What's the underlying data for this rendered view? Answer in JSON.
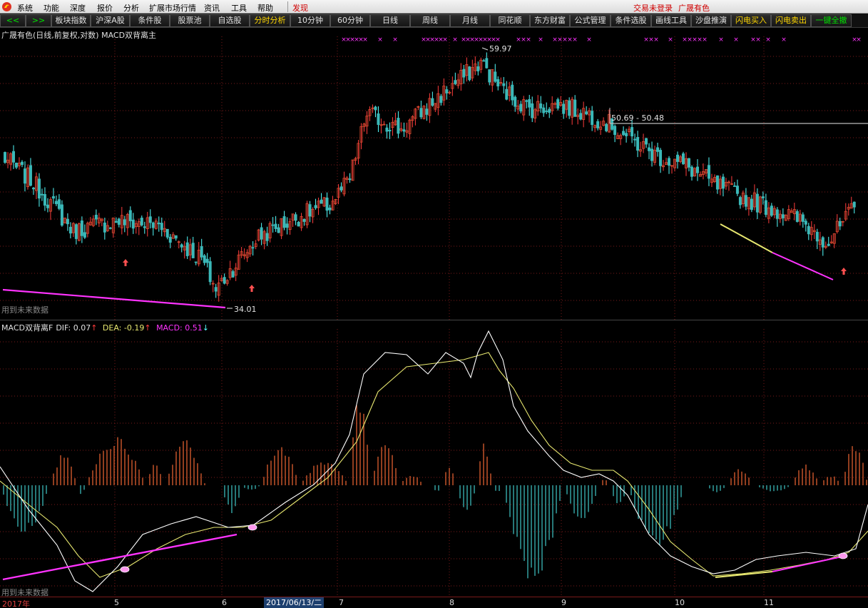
{
  "menu": {
    "items": [
      "系统",
      "功能",
      "深度",
      "报价",
      "分析",
      "扩展市场行情",
      "资讯",
      "工具",
      "帮助"
    ],
    "discover": "发现",
    "login_status": "交易未登录",
    "stock_name": "广晟有色"
  },
  "toolbar": {
    "items": [
      "<<",
      ">>",
      "板块指数",
      "沪深A股",
      "条件股",
      "股票池",
      "自选股",
      "分时分析",
      "10分钟",
      "60分钟",
      "日线",
      "周线",
      "月线",
      "同花顺",
      "东方财富",
      "公式管理",
      "条件选股",
      "画线工具",
      "沙盘推演",
      "闪电买入",
      "闪电卖出",
      "一键全撤"
    ]
  },
  "kline": {
    "title": "广晟有色(日线,前复权,对数) MACD双背离主",
    "high_label": "59.97",
    "low_label": "34.01",
    "range_label": "50.69 - 50.48",
    "future_note": "用到未来数据"
  },
  "macd": {
    "name": "MACD双背离F",
    "dif": "DIF: 0.07",
    "dif_arrow": "↑",
    "dea": "DEA: -0.19",
    "dea_arrow": "↑",
    "macd": "MACD: 0.51",
    "macd_arrow": "↓",
    "future_note": "用到未来数据"
  },
  "timeaxis": {
    "year": "2017年",
    "months": [
      "5",
      "6",
      "7",
      "8",
      "9",
      "10",
      "11"
    ],
    "cursor_date": "2017/06/13/二"
  },
  "colors": {
    "up": "#ff3c3c",
    "up_body": "#e05030",
    "down": "#54ffff",
    "down_body": "#3ab8b8",
    "divergence": "#ff33ff",
    "dif_line": "#ffffff",
    "dea_line": "#e8e870",
    "bar_up": "#e06030",
    "bar_down": "#3ab8b8",
    "grid": "#7a1a1a"
  },
  "chart_data": [
    {
      "type": "candlestick",
      "title": "广晟有色(日线,前复权,对数) MACD双背离主",
      "scale": "log",
      "grid": true,
      "high_marker": 59.97,
      "low_marker": 34.01,
      "range_marker": [
        50.69,
        50.48
      ],
      "close_path": [
        [
          0,
          47.0
        ],
        [
          10,
          44.5
        ],
        [
          25,
          39.5
        ],
        [
          40,
          40.5
        ],
        [
          55,
          40.0
        ],
        [
          70,
          37.0
        ],
        [
          75,
          34.5
        ],
        [
          90,
          39.0
        ],
        [
          105,
          41.0
        ],
        [
          115,
          42.0
        ],
        [
          122,
          44.5
        ],
        [
          128,
          52.0
        ],
        [
          140,
          50.0
        ],
        [
          150,
          53.0
        ],
        [
          160,
          56.0
        ],
        [
          168,
          58.5
        ],
        [
          175,
          55.0
        ],
        [
          185,
          52.5
        ],
        [
          195,
          53.0
        ],
        [
          205,
          52.0
        ],
        [
          213,
          50.7
        ],
        [
          220,
          49.0
        ],
        [
          230,
          47.0
        ],
        [
          240,
          46.0
        ],
        [
          250,
          44.0
        ],
        [
          262,
          42.5
        ],
        [
          272,
          41.5
        ],
        [
          280,
          40.5
        ],
        [
          290,
          38.5
        ],
        [
          300,
          42.0
        ]
      ]
    },
    {
      "type": "line",
      "title": "MACD双背离F",
      "series": [
        {
          "name": "DIF",
          "value": 0.07
        },
        {
          "name": "DEA",
          "value": -0.19
        },
        {
          "name": "MACD",
          "value": 0.51
        }
      ]
    }
  ]
}
